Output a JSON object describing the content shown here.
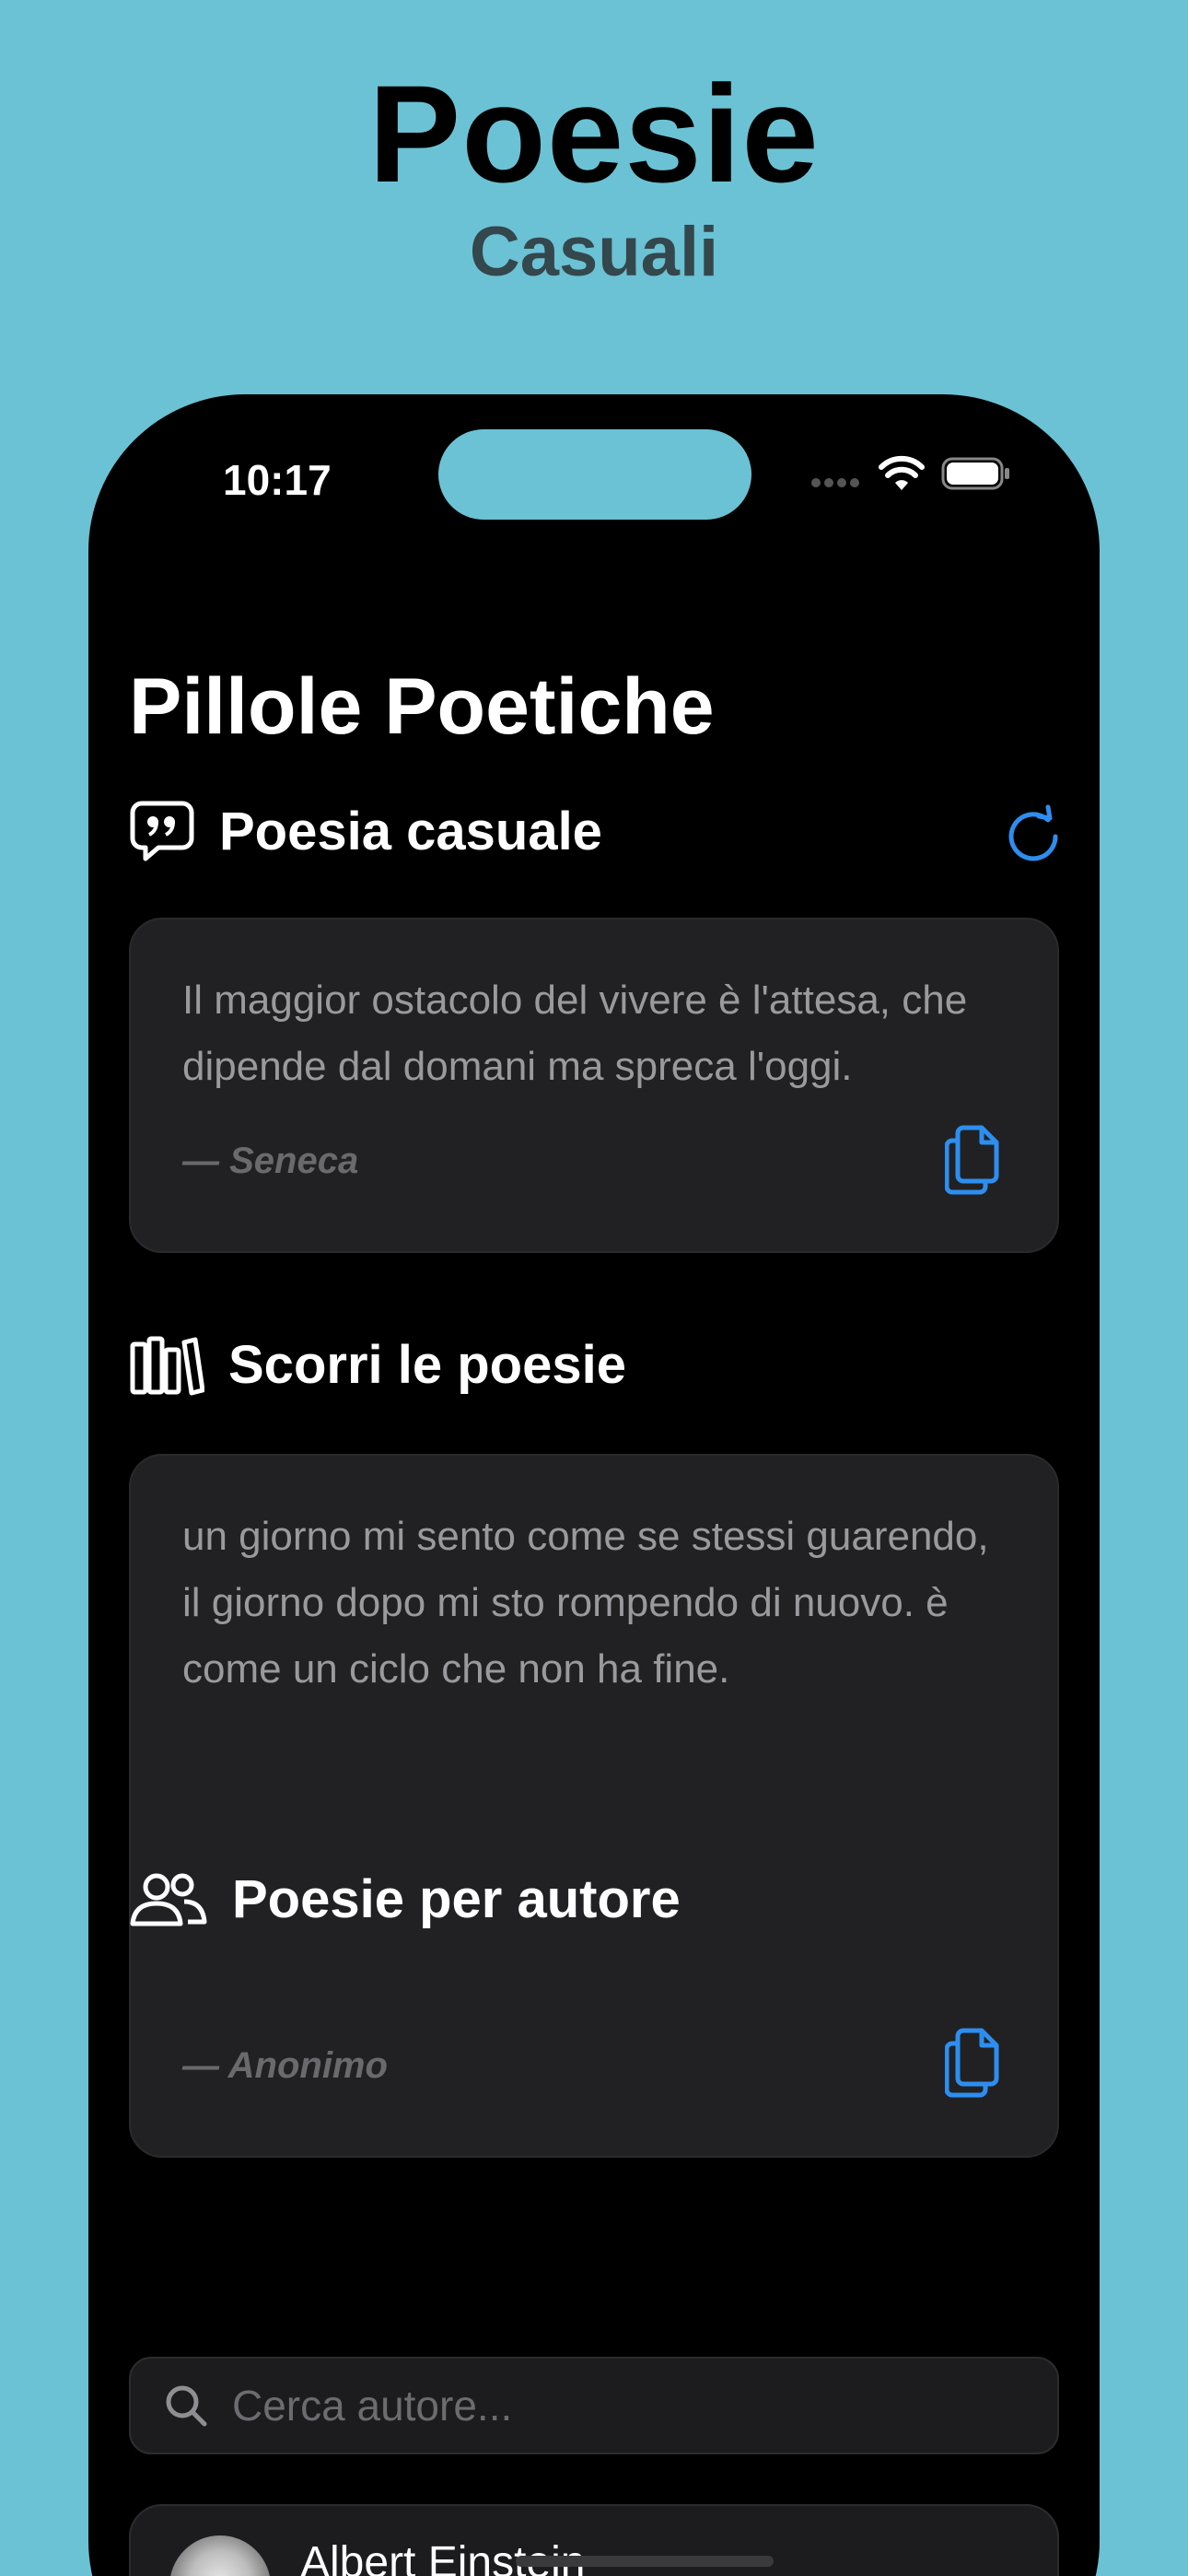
{
  "promo": {
    "title": "Poesie",
    "subtitle": "Casuali"
  },
  "status_bar": {
    "time": "10:17"
  },
  "app": {
    "title": "Pillole Poetiche"
  },
  "random_section": {
    "title": "Poesia casuale",
    "icon": "quote-bubble-icon",
    "refresh_icon": "refresh-icon",
    "poem": "Il maggior ostacolo del vivere è l'attesa, che dipende dal domani ma spreca l'oggi.",
    "author": "— Seneca"
  },
  "browse_section": {
    "title": "Scorri le poesie",
    "icon": "books-icon",
    "poem": "un giorno mi sento come se stessi guarendo, il giorno dopo mi sto rompendo di nuovo. è come un ciclo che non ha fine.",
    "author": "— Anonimo"
  },
  "author_section": {
    "title": "Poesie per autore",
    "icon": "people-icon",
    "search_placeholder": "Cerca autore...",
    "authors": [
      {
        "name": "Albert Einstein"
      }
    ]
  },
  "colors": {
    "background": "#6bc2d4",
    "accent": "#2d8ef0",
    "card": "#212123"
  }
}
